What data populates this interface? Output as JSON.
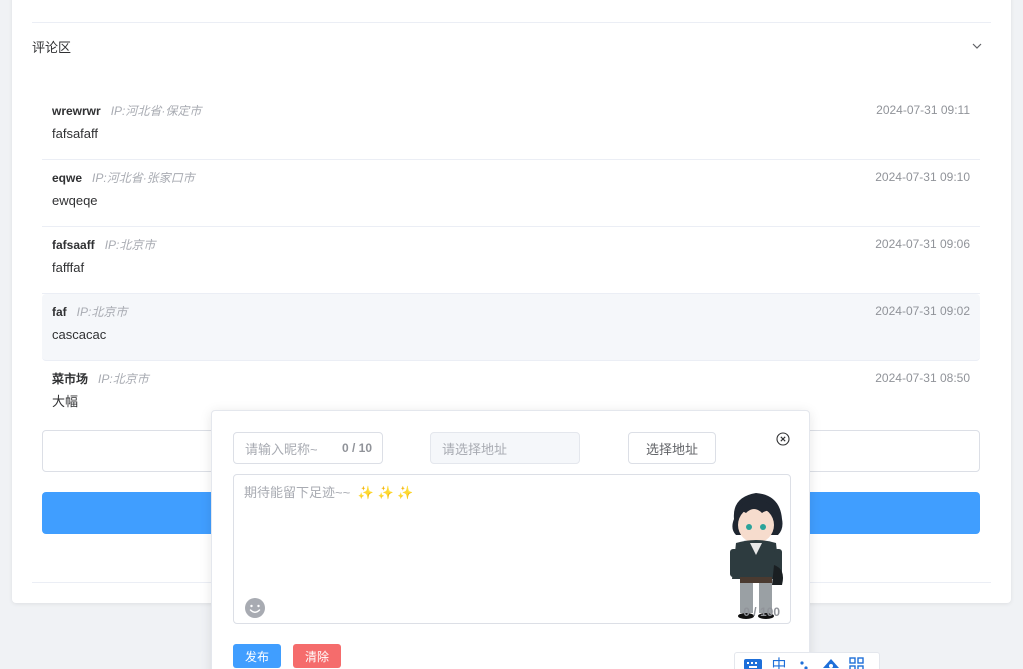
{
  "section": {
    "title": "评论区"
  },
  "comments": [
    {
      "name": "wrewrwr",
      "ip": "IP:河北省·保定市",
      "time": "2024-07-31 09:11",
      "text": "fafsafaff"
    },
    {
      "name": "eqwe",
      "ip": "IP:河北省·张家口市",
      "time": "2024-07-31 09:10",
      "text": "ewqeqe"
    },
    {
      "name": "fafsaaff",
      "ip": "IP:北京市",
      "time": "2024-07-31 09:06",
      "text": "fafffaf"
    },
    {
      "name": "faf",
      "ip": "IP:北京市",
      "time": "2024-07-31 09:02",
      "text": "cascacac"
    },
    {
      "name": "菜市场",
      "ip": "IP:北京市",
      "time": "2024-07-31 08:50",
      "text": "大幅"
    }
  ],
  "form": {
    "nickname_placeholder": "请输入昵称~",
    "nickname_count": "0 / 10",
    "address_placeholder": "请选择地址",
    "choose_address_label": "选择地址",
    "content_placeholder": "期待能留下足迹~~",
    "content_sparkles": "✨ ✨ ✨",
    "content_count": "0 / 100",
    "publish_label": "发布",
    "clear_label": "清除"
  },
  "ime_toolbar": {
    "mode": "中",
    "items": [
      "keyboard-icon",
      "punctuation-icon",
      "skin-icon",
      "grid-icon"
    ]
  },
  "colors": {
    "primary": "#409eff",
    "danger": "#f56c6c",
    "ime": "#1e6fd9"
  }
}
